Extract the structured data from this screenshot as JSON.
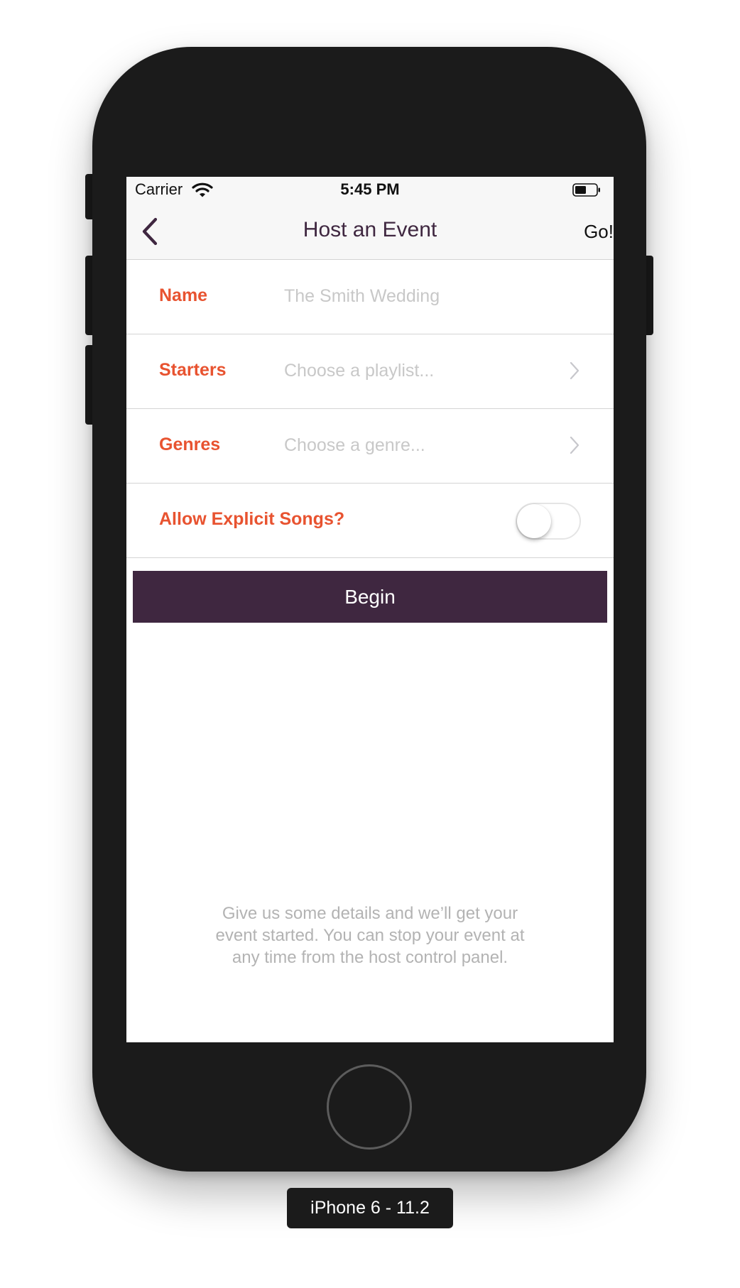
{
  "status_bar": {
    "carrier": "Carrier",
    "time": "5:45 PM",
    "wifi_icon": "wifi-icon",
    "battery_icon": "battery-icon"
  },
  "nav": {
    "back_icon": "chevron-left-icon",
    "title": "Host an Event",
    "right_button": "Go!"
  },
  "form": {
    "rows": [
      {
        "label": "Name",
        "placeholder": "The Smith Wedding"
      },
      {
        "label": "Starters",
        "placeholder": "Choose a playlist...",
        "accessory": "chevron-right-icon"
      },
      {
        "label": "Genres",
        "placeholder": "Choose a genre...",
        "accessory": "chevron-right-icon"
      }
    ],
    "explicit": {
      "label": "Allow Explicit Songs?",
      "enabled": false
    }
  },
  "begin_button": "Begin",
  "footer_text": "Give us some details and we’ll get your event started. You can stop your event at any time from the host control panel.",
  "device_label": "iPhone 6 - 11.2",
  "colors": {
    "accent": "#e85330",
    "brand": "#3f2740",
    "placeholder": "#c8c8c8",
    "footer": "#b3b3b3"
  }
}
